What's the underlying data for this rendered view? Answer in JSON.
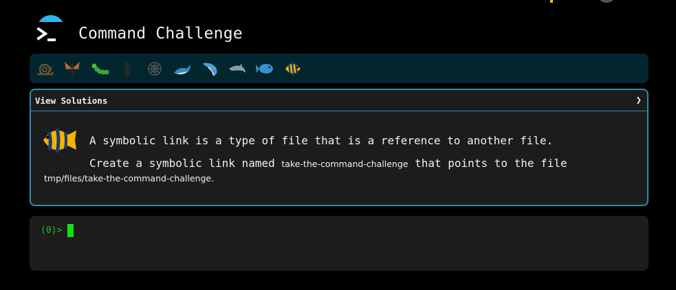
{
  "app": {
    "title": "Command Challenge"
  },
  "levels": [
    {
      "icon": "snail-icon",
      "color": "#7a5a2a"
    },
    {
      "icon": "butterfly-icon",
      "color": "#b06a2a"
    },
    {
      "icon": "caterpillar-icon",
      "color": "#3aa83a"
    },
    {
      "icon": "ant-icon",
      "color": "#2a2a2a"
    },
    {
      "icon": "spider-web-icon",
      "color": "#5a5a5a"
    },
    {
      "icon": "whale-icon",
      "color": "#3a8ab8"
    },
    {
      "icon": "shark-icon",
      "color": "#4aa0d8"
    },
    {
      "icon": "dolphin-icon",
      "color": "#8a9aa8"
    },
    {
      "icon": "fish-icon",
      "color": "#3a90d0"
    },
    {
      "icon": "angelfish-icon",
      "color": "#f2b400"
    }
  ],
  "panel": {
    "header_label": "View Solutions",
    "chevron": "❯",
    "icon": "angelfish-icon",
    "line1": "A symbolic link is a type of file that is a reference to another file.",
    "line2_prefix": "Create a symbolic link named ",
    "link_name": "take-the-command-challenge",
    "line2_suffix": " that points to the file",
    "target_path": "tmp/files/take-the-command-challenge",
    "end_punct": "."
  },
  "terminal": {
    "prompt": "(0)>",
    "input_value": ""
  },
  "colors": {
    "accent": "#2a8fb0",
    "prompt": "#1fc11f",
    "cursor": "#11e211",
    "logo": "#2bb8ec"
  }
}
